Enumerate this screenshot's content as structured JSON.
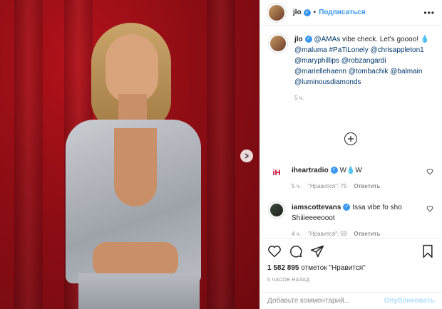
{
  "post": {
    "username": "jlo",
    "follow_label": "Подписаться",
    "dot": "•",
    "caption_mention": "@AMAs",
    "caption_text": " vibe check. Let's goooo!",
    "caption_drop": "💧 ",
    "caption_links": "@maluma #PaTiLonely @chrisappleton1 @maryphillips @robzangardi @mariellehaenn @tombachik @balmain @luminousdiamonds",
    "caption_time": "5 ч.",
    "comments": [
      {
        "username": "iheartradio",
        "text": " W💧W",
        "time": "5 ч.",
        "likes": "\"Нравится\": 75",
        "reply": "Ответить"
      },
      {
        "username": "iamscottevans",
        "text": " Issa vibe fo sho Shiiieeeeooot",
        "time": "4 ч.",
        "likes": "\"Нравится\": 59",
        "reply": "Ответить"
      }
    ],
    "likes_count": "1 582 895",
    "likes_label": " отметок \"Нравится\"",
    "posted_ago": "5 ЧАСОВ НАЗАД",
    "comment_placeholder": "Добавьте комментарий...",
    "publish_label": "Опубликовать"
  },
  "icons": {
    "verified": "verified-badge-icon",
    "more": "more-options-icon",
    "next": "chevron-right-icon",
    "load_more": "plus-circle-icon",
    "heart": "heart-icon",
    "comment": "comment-icon",
    "share": "share-icon",
    "save": "bookmark-icon"
  },
  "colors": {
    "accent": "#3897f0",
    "publish_disabled": "#b2dffc",
    "text": "#262626",
    "muted": "#8e8e8e"
  }
}
